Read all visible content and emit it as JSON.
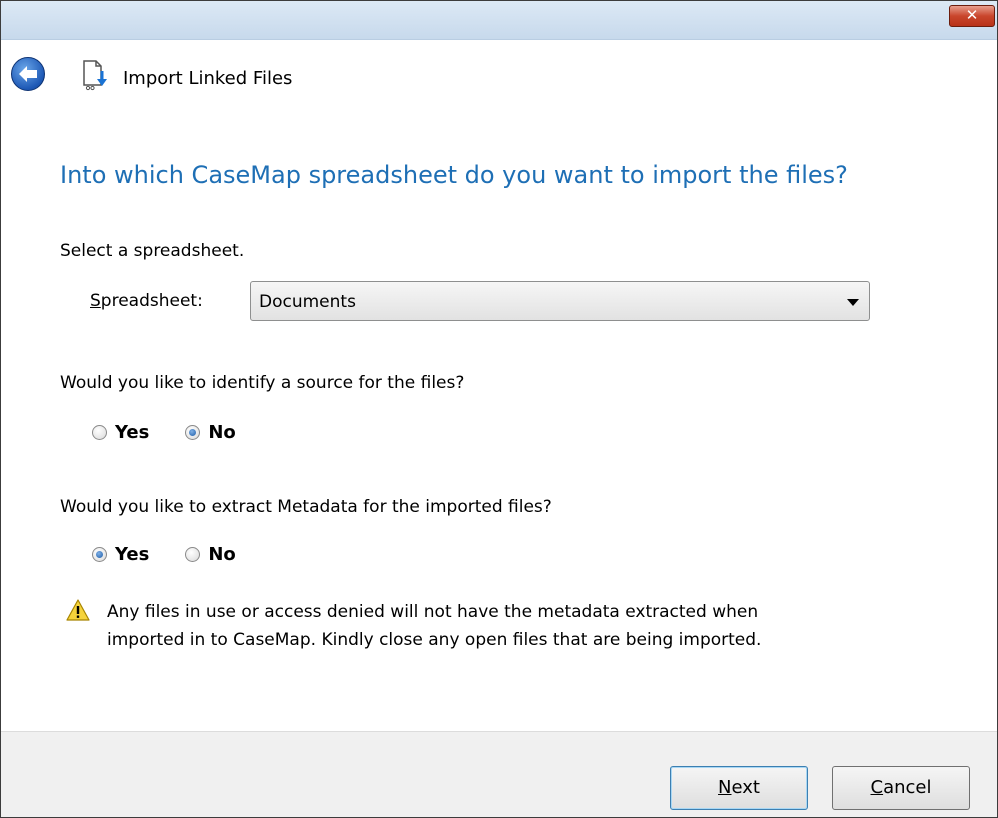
{
  "window": {
    "close_glyph": "✕"
  },
  "nav": {
    "title": "Import Linked Files",
    "back_icon": "back-arrow-icon",
    "wizard_icon": "import-file-icon"
  },
  "main": {
    "heading": "Into which CaseMap spreadsheet do you want to import the files?",
    "select_prompt": "Select a spreadsheet.",
    "spreadsheet_label": {
      "accel": "S",
      "rest": "preadsheet:"
    },
    "spreadsheet_value": "Documents",
    "source_question": "Would you like to identify a source for the files?",
    "source_options": [
      {
        "label": "Yes",
        "checked": false
      },
      {
        "label": "No",
        "checked": true
      }
    ],
    "metadata_question": "Would you like to extract Metadata for the imported files?",
    "metadata_options": [
      {
        "label": "Yes",
        "checked": true
      },
      {
        "label": "No",
        "checked": false
      }
    ],
    "warning_line1": "Any files in use or access denied will not have the metadata extracted when",
    "warning_line2": "imported in to CaseMap. Kindly close any open files that are being imported."
  },
  "footer": {
    "next": {
      "accel": "N",
      "rest": "ext"
    },
    "cancel": {
      "accel": "C",
      "rest": "ancel"
    }
  },
  "colors": {
    "heading": "#1e6fb5",
    "footer_bg": "#f0f0f0",
    "close_red": "#c9462c"
  }
}
